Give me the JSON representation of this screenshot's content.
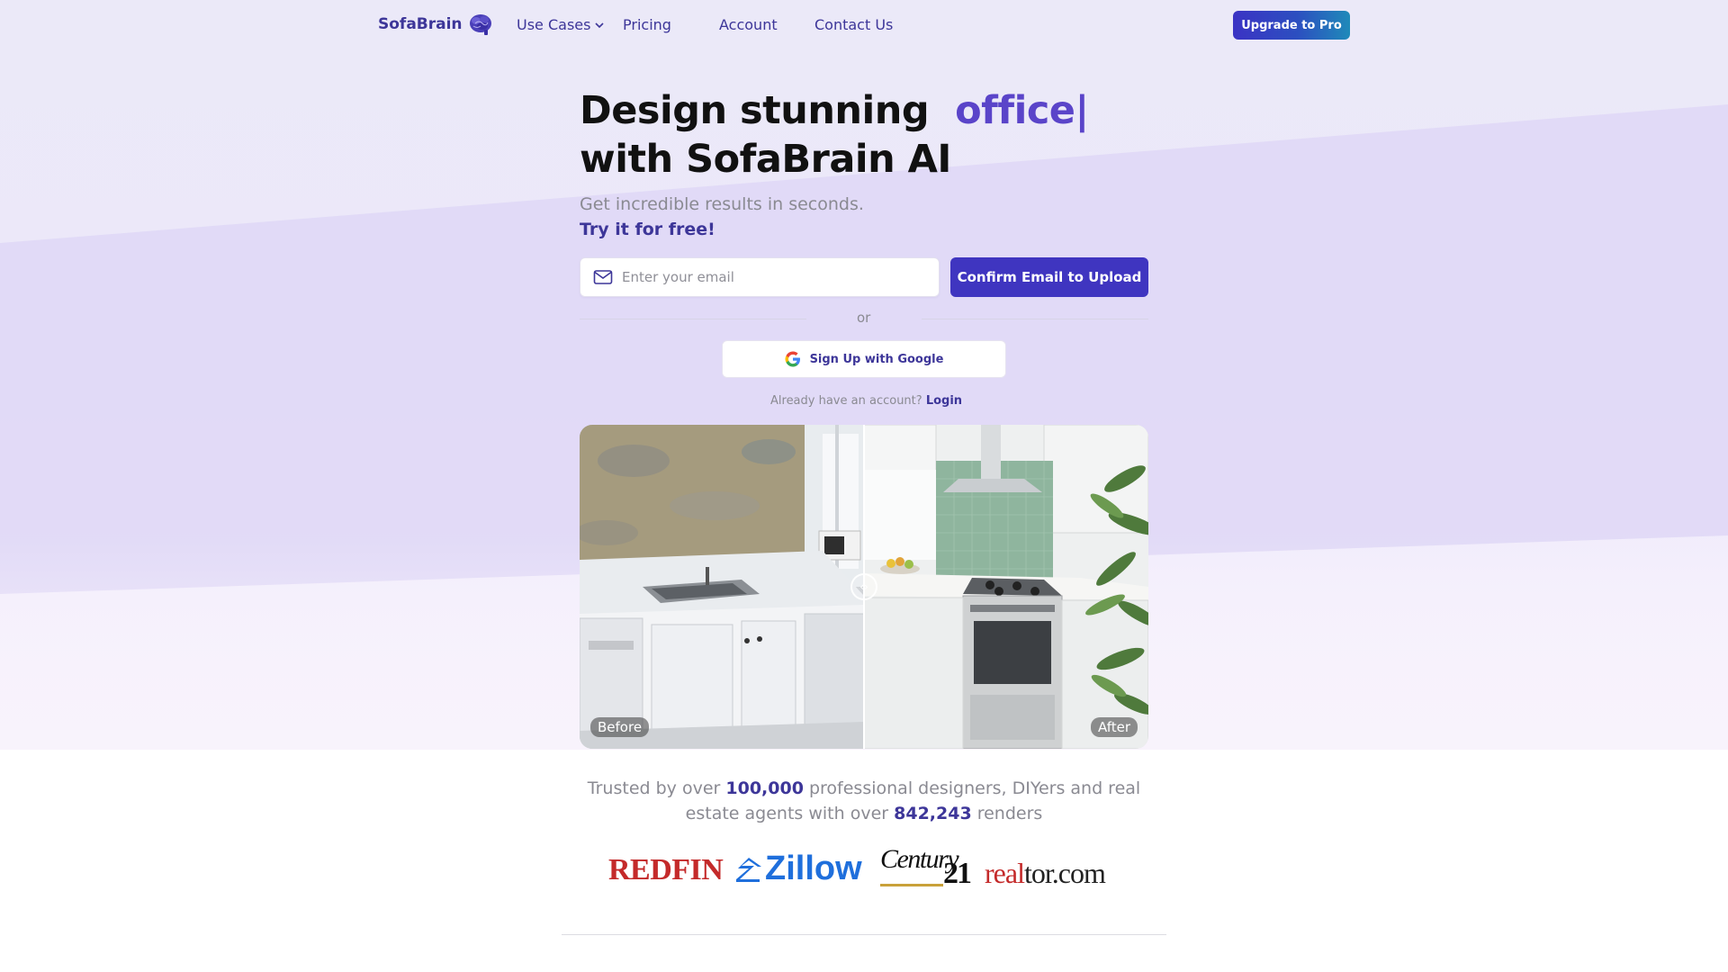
{
  "nav": {
    "logo_text": "SofaBrain",
    "logo_icon": "brain-icon",
    "links": [
      {
        "label": "Use Cases",
        "has_dropdown": true
      },
      {
        "label": "Pricing"
      },
      {
        "label": "Account"
      },
      {
        "label": "Contact Us"
      }
    ],
    "upgrade_label": "Upgrade to Pro"
  },
  "hero": {
    "headline_prefix": "Design stunning",
    "headline_accent": "office|",
    "headline_line2": "with SofaBrain AI",
    "subtitle": "Get incredible results in seconds.",
    "cta_text": "Try it for free!",
    "email_placeholder": "Enter your email",
    "email_value": "",
    "confirm_label": "Confirm Email to Upload",
    "or_text": "or",
    "google_label": "Sign Up with Google",
    "already_text": "Already have an account?",
    "login_label": "Login"
  },
  "compare": {
    "before_label": "Before",
    "after_label": "After",
    "split_position": 0.5
  },
  "trusted": {
    "prefix": "Trusted by over",
    "users": "100,000",
    "middle": "professional designers, DIYers and real estate agents with over",
    "renders": "842,243",
    "suffix": "renders"
  },
  "logos": {
    "redfin": "REDFIN",
    "zillow": "Zillow",
    "century_word": "Century",
    "century_num": "21",
    "realtor_a": "real",
    "realtor_b": "tor.com"
  },
  "colors": {
    "brand": "#3d3699",
    "accent": "#5a44c9",
    "button": "#3f35c0",
    "hero_bg": "#ebe9f8"
  }
}
